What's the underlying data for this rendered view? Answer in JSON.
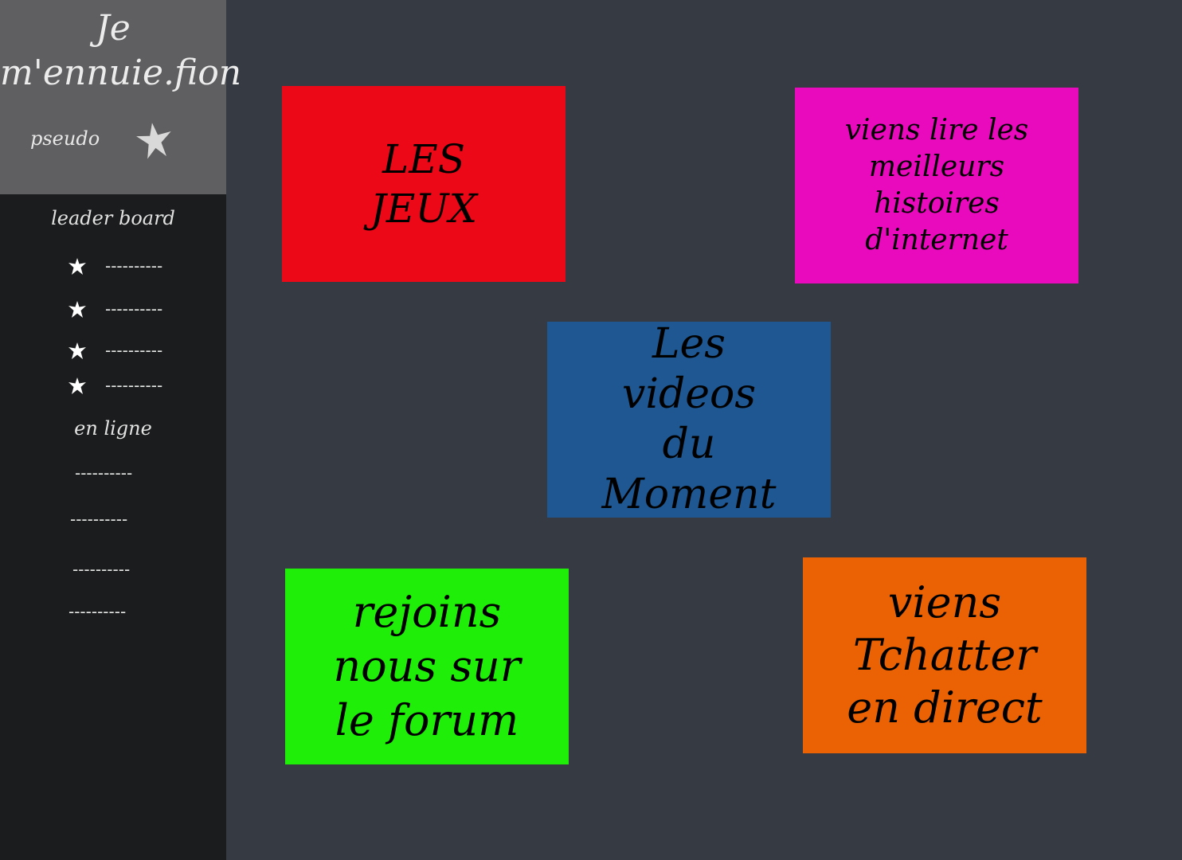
{
  "site": {
    "title_line1": "Je",
    "title_line2": "m'ennuie.fion"
  },
  "user": {
    "pseudo": "pseudo",
    "avatar_icon": "star-icon"
  },
  "leaderboard": {
    "title": "leader board",
    "entries": [
      "----------",
      "----------",
      "----------",
      "----------"
    ]
  },
  "online": {
    "title": "en ligne",
    "users": [
      "----------",
      "----------",
      "----------",
      "----------"
    ]
  },
  "tiles": {
    "games": {
      "lines": [
        "LES",
        "JEUX"
      ],
      "color": "#ec0817"
    },
    "stories": {
      "lines": [
        "viens lire les",
        "meilleurs",
        "histoires",
        "d'internet"
      ],
      "color": "#e80abc"
    },
    "videos": {
      "lines": [
        "Les videos",
        "du",
        "Moment"
      ],
      "color": "#1e5791"
    },
    "forum": {
      "lines": [
        "rejoins",
        "nous sur",
        "le forum"
      ],
      "color": "#1fee09"
    },
    "chat": {
      "lines": [
        "viens",
        "Tchatter",
        "en direct"
      ],
      "color": "#eb6205"
    }
  },
  "colors": {
    "background": "#363a42",
    "sidebar": "#1b1c1d",
    "sidebar_header": "#5f5f61"
  }
}
